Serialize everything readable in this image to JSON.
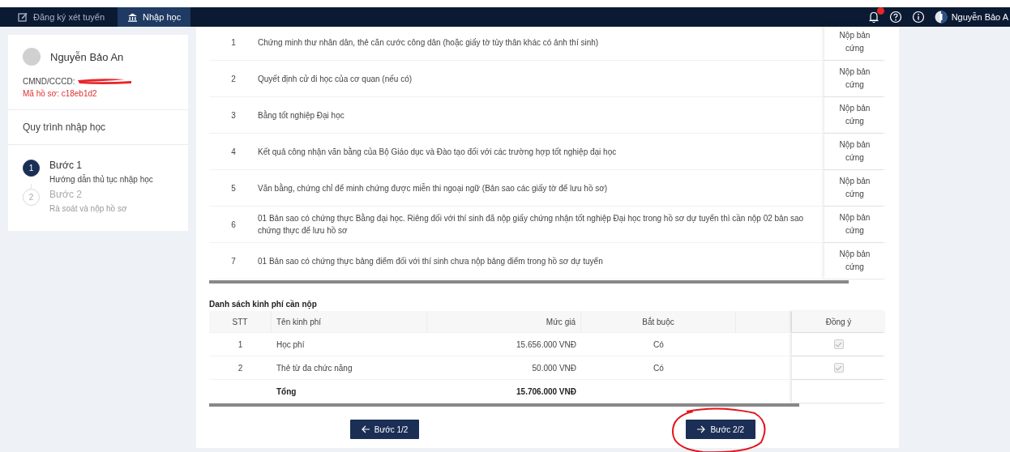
{
  "nav": {
    "tabs": [
      {
        "label": "Đăng ký xét tuyển",
        "selected": false
      },
      {
        "label": "Nhập học",
        "selected": true
      }
    ],
    "notifications": {
      "badge": true
    },
    "user_name": "Nguyễn Bảo A"
  },
  "profile": {
    "name": "Nguyễn Bảo An",
    "id_label": "CMND/CCCD:",
    "id_redacted": true,
    "file_code": "Mã hồ sơ: c18eb1d2"
  },
  "process": {
    "title": "Quy trình nhập học",
    "steps": [
      {
        "number": "1",
        "title": "Bước 1",
        "subtitle": "Hướng dẫn thủ tục nhập học",
        "selected": true
      },
      {
        "number": "2",
        "title": "Bước 2",
        "subtitle": "Rà soát và nộp hồ sơ",
        "selected": false
      }
    ]
  },
  "documents": {
    "rows": [
      {
        "stt": "1",
        "name": "Chứng minh thư nhân dân, thẻ căn cước công dân (hoặc giấy tờ tùy thân khác có ảnh thí sinh)",
        "method": "Nộp bản cứng"
      },
      {
        "stt": "2",
        "name": "Quyết định cử đi học của cơ quan (nếu có)",
        "method": "Nộp bản cứng"
      },
      {
        "stt": "3",
        "name": "Bằng tốt nghiệp Đại học",
        "method": "Nộp bản cứng"
      },
      {
        "stt": "4",
        "name": "Kết quả công nhận văn bằng của Bộ Giáo dục và Đào tạo đối với các trường hợp tốt nghiệp đại học",
        "method": "Nộp bản cứng"
      },
      {
        "stt": "5",
        "name": "Văn bằng, chứng chỉ để minh chứng được miễn thi ngoại ngữ (Bản sao các giấy tờ để lưu hồ sơ)",
        "method": "Nộp bản cứng"
      },
      {
        "stt": "6",
        "name": "01 Bản sao có chứng thực Bằng đại học. Riêng đối với thí sinh đã nộp giấy chứng nhận tốt nghiệp Đại học trong hồ sơ dự tuyển thì cần nộp 02 bản sao chứng thực để lưu hồ sơ",
        "method": "Nộp bản cứng"
      },
      {
        "stt": "7",
        "name": "01 Bản sao có chứng thực bảng điểm đối với thí sinh chưa nộp bảng điểm trong hồ sơ dự tuyển",
        "method": "Nộp bản cứng"
      }
    ]
  },
  "fees": {
    "title": "Danh sách kinh phí cần nộp",
    "columns": [
      "STT",
      "Tên kinh phí",
      "Mức giá",
      "Bắt buộc",
      "Đồng ý"
    ],
    "rows": [
      {
        "stt": "1",
        "name": "Học phí",
        "price": "15.656.000 VNĐ",
        "required": "Có",
        "agreed": true,
        "disabled": true
      },
      {
        "stt": "2",
        "name": "Thẻ từ đa chức năng",
        "price": "50.000 VNĐ",
        "required": "Có",
        "agreed": true,
        "disabled": true
      }
    ],
    "total": {
      "label": "Tổng",
      "price": "15.706.000 VNĐ"
    }
  },
  "buttons": [
    {
      "label": "Bước 1/2",
      "kind": "back",
      "circled": false
    },
    {
      "label": "Bước 2/2",
      "kind": "next",
      "circled": true
    }
  ]
}
